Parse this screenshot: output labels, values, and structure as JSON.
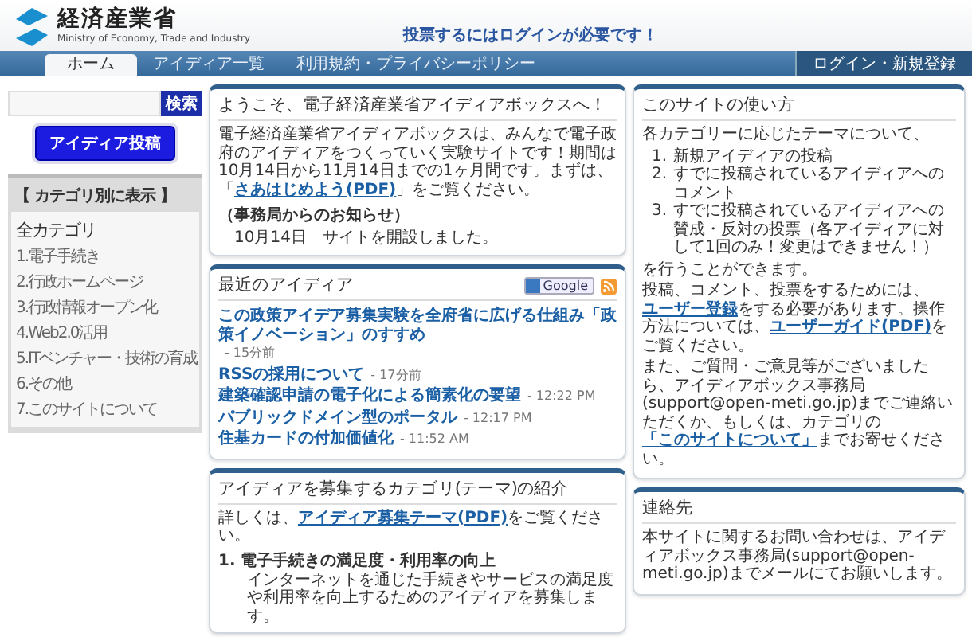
{
  "header": {
    "logo_title": "経済産業省",
    "logo_subtitle": "Ministry of Economy, Trade and Industry",
    "notice": "投票するにはログインが必要です！"
  },
  "nav": {
    "tabs": [
      {
        "label": "ホーム",
        "selected": true
      },
      {
        "label": "アイディア一覧",
        "selected": false
      },
      {
        "label": "利用規約・プライバシーポリシー",
        "selected": false
      }
    ],
    "login": "ログイン・新規登録"
  },
  "sidebar": {
    "search_button": "検索",
    "post_button": "アイディア投稿",
    "category_panel": {
      "title": "【 カテゴリ別に表示 】",
      "items": [
        {
          "label": "全カテゴリ",
          "selected": true
        },
        {
          "label": "1.電子手続き",
          "selected": false
        },
        {
          "label": "2.行政ホームページ",
          "selected": false
        },
        {
          "label": "3.行政情報オープン化",
          "selected": false
        },
        {
          "label": "4.Web2.0活用",
          "selected": false
        },
        {
          "label": "5.ITベンチャー・技術の育成",
          "selected": false
        },
        {
          "label": "6.その他",
          "selected": false
        },
        {
          "label": "7.このサイトについて",
          "selected": false
        }
      ]
    }
  },
  "welcome": {
    "title": "ようこそ、電子経済産業省アイディアボックスへ！",
    "paragraph": [
      {
        "kind": "text",
        "text": "電子経済産業省アイディアボックスは、みんなで電子政府のアイディアをつくっていく実験サイトです！期間は10月14日から11月14日までの1ヶ月間です。まずは、「"
      },
      {
        "kind": "link",
        "text": "さあはじめよう(PDF)"
      },
      {
        "kind": "text",
        "text": "」をご覧ください。"
      }
    ],
    "news_heading": "（事務局からのお知らせ）",
    "news": [
      "10月14日　サイトを開設しました。"
    ]
  },
  "recent_ideas": {
    "title": "最近のアイディア",
    "google_button": "Google",
    "items": [
      {
        "title": "この政策アイデア募集実験を全府省に広げる仕組み「政策イノベーション」のすすめ",
        "time": "- 15分前"
      },
      {
        "title": "RSSの採用について",
        "time": "- 17分前"
      },
      {
        "title": "建築確認申請の電子化による簡素化の要望",
        "time": "- 12:22 PM"
      },
      {
        "title": "パブリックドメイン型のポータル",
        "time": "- 12:17 PM"
      },
      {
        "title": "住基カードの付加価値化",
        "time": "- 11:52 AM"
      }
    ]
  },
  "categories_intro": {
    "title": "アイディアを募集するカテゴリ(テーマ)の紹介",
    "paragraph": [
      {
        "kind": "text",
        "text": "詳しくは、"
      },
      {
        "kind": "link",
        "text": "アイディア募集テーマ(PDF)"
      },
      {
        "kind": "text",
        "text": "をご覧ください。"
      }
    ],
    "themes": [
      {
        "number": "1.",
        "title": "電子手続きの満足度・利用率の向上",
        "bullets": [
          "インターネットを通じた手続きやサービスの満足度や利用率を向上するためのアイディアを募集します。"
        ]
      }
    ]
  },
  "how_to": {
    "title": "このサイトの使い方",
    "intro": "各カテゴリーに応じたテーマについて、",
    "steps": [
      {
        "number": "1.",
        "text": "新規アイディアの投稿"
      },
      {
        "number": "2.",
        "text": "すでに投稿されているアイディアへのコメント"
      },
      {
        "number": "3.",
        "text": "すでに投稿されているアイディアへの賛成・反対の投票（各アイディアに対して1回のみ！変更はできません！）"
      }
    ],
    "after": "を行うことができます。",
    "paragraphs": [
      [
        {
          "kind": "text",
          "text": "投稿、コメント、投票をするためには、"
        },
        {
          "kind": "link",
          "text": "ユーザー登録"
        },
        {
          "kind": "text",
          "text": "をする必要があります。操作方法については、"
        },
        {
          "kind": "link",
          "text": "ユーザーガイド(PDF)"
        },
        {
          "kind": "text",
          "text": "をご覧ください。"
        }
      ],
      [
        {
          "kind": "text",
          "text": "また、ご質問・ご意見等がございましたら、アイディアボックス事務局(support@open-meti.go.jp)までご連絡いただくか、もしくは、カテゴリの"
        },
        {
          "kind": "link",
          "text": "「このサイトについて」"
        },
        {
          "kind": "text",
          "text": "までお寄せください。"
        }
      ]
    ]
  },
  "contact": {
    "title": "連絡先",
    "text": "本サイトに関するお問い合わせは、アイディアボックス事務局(support@open-meti.go.jp)までメールにてお願いします。"
  }
}
